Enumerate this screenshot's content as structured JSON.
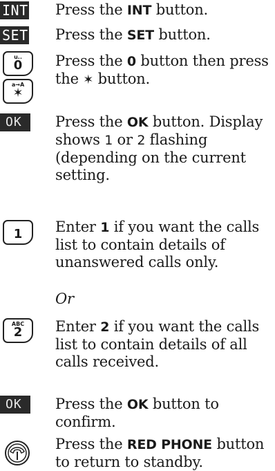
{
  "steps": [
    {
      "key_label": "INT",
      "text_before": "Press the ",
      "bold": "INT",
      "text_after": " button."
    },
    {
      "key_label": "SET",
      "text_before": "Press the ",
      "bold": "SET",
      "text_after": " button."
    },
    {
      "key_label": "0",
      "key_sub": "u..",
      "key2_label": "✶",
      "key2_sub": "a→A",
      "text_before": "Press the ",
      "bold": "0",
      "text_mid": " button then press the ",
      "symbol": "✶",
      "text_after": " button."
    },
    {
      "key_label": "OK",
      "text_before": "Press the ",
      "bold": "OK",
      "text_mid": " button. Display shows ",
      "digit1": "1",
      "text_or": " or ",
      "digit2": "2",
      "text_after": " flashing (depending on the current setting."
    },
    {
      "key_label": "1",
      "text_before": "Enter ",
      "bold": "1",
      "text_after": " if you want the calls list to contain details of unanswered calls only."
    },
    {
      "or_text": "Or"
    },
    {
      "key_label": "2",
      "key_sub": "ABC",
      "text_before": "Enter ",
      "bold": "2",
      "text_after": " if you want the calls list to contain details of all calls received."
    },
    {
      "key_label": "OK",
      "text_before": "Press the ",
      "bold": "OK",
      "text_after": " button to confirm."
    },
    {
      "key_label": "red-phone-icon",
      "text_before": "Press the ",
      "bold": "RED PHONE",
      "text_after": " button to return to standby."
    }
  ]
}
